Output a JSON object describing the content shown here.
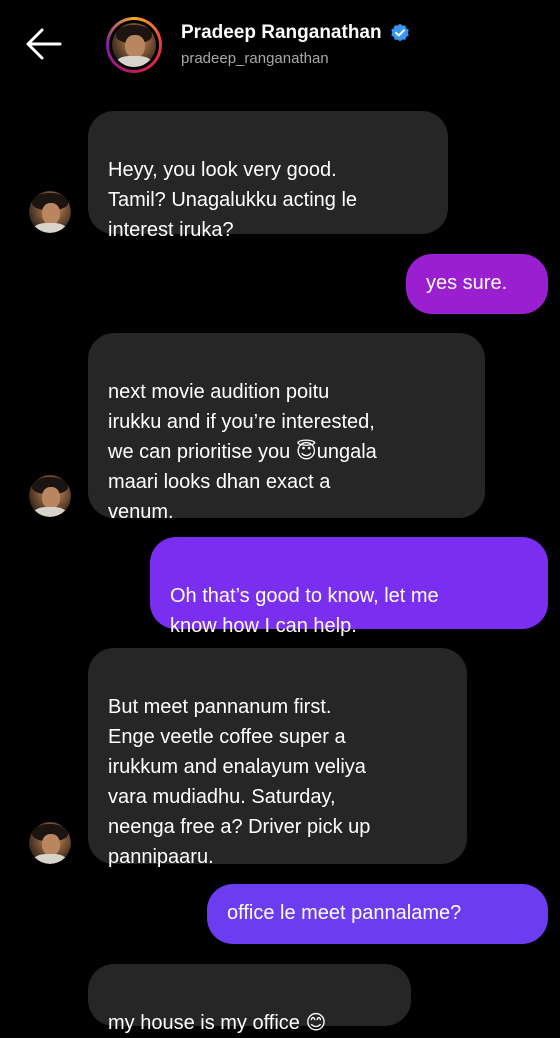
{
  "header": {
    "name": "Pradeep Ranganathan",
    "handle": "pradeep_ranganathan",
    "back_icon": "arrow-left-icon",
    "verified_icon": "verified-badge-icon",
    "verified_color": "#3897f0",
    "ring_colors": [
      "#f9a825",
      "#e53935",
      "#c2185b",
      "#7b1fa2"
    ]
  },
  "messages": [
    {
      "direction": "incoming",
      "text": "Heyy, you look very good.\nTamil? Unagalukku acting le\ninterest iruka?"
    },
    {
      "direction": "outgoing",
      "text": "yes sure."
    },
    {
      "direction": "incoming",
      "text": "next movie audition poitu\nirukku and if you’re interested,\nwe can prioritise you 😇ungala\nmaari looks dhan exact a\nvenum."
    },
    {
      "direction": "outgoing",
      "text": "Oh that’s good to know, let me\nknow how I can help."
    },
    {
      "direction": "incoming",
      "text": "But meet pannanum first.\nEnge veetle coffee super a\nirukkum and enalayum veliya\nvara mudiadhu. Saturday,\nneenga free a? Driver pick up\npannipaaru."
    },
    {
      "direction": "outgoing",
      "text": "office le meet pannalame?"
    },
    {
      "direction": "incoming",
      "text": "my house is my office 😊"
    }
  ],
  "colors": {
    "background": "#000000",
    "incoming_bubble": "#262626",
    "outgoing_gradient": [
      "#9a1fd0",
      "#7a2ef0",
      "#6b3cf0",
      "#5b4bf0"
    ]
  }
}
